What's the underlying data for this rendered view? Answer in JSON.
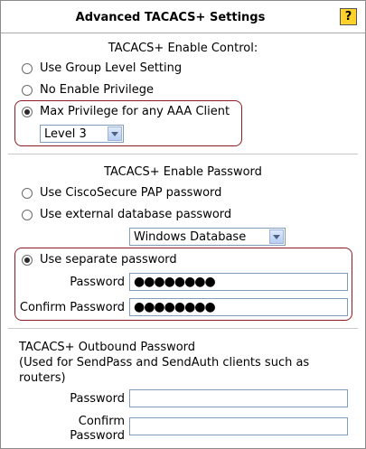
{
  "header": {
    "title": "Advanced TACACS+ Settings",
    "help_label": "?"
  },
  "enable_control": {
    "title": "TACACS+ Enable Control:",
    "options": [
      {
        "label": "Use Group Level Setting",
        "selected": false
      },
      {
        "label": "No Enable Privilege",
        "selected": false
      },
      {
        "label": "Max Privilege for any AAA Client",
        "selected": true
      }
    ],
    "level_select": "Level 3"
  },
  "enable_password": {
    "title": "TACACS+ Enable Password",
    "options": [
      {
        "label": "Use CiscoSecure PAP password",
        "selected": false
      },
      {
        "label": "Use external database password",
        "selected": false
      },
      {
        "label": "Use separate password",
        "selected": true
      }
    ],
    "database_select": "Windows Database",
    "password_label": "Password",
    "password_value": "●●●●●●●●",
    "confirm_label": "Confirm Password",
    "confirm_value": "●●●●●●●●"
  },
  "outbound": {
    "title_line1": "TACACS+ Outbound Password",
    "title_line2": "(Used for SendPass and SendAuth clients such as",
    "title_line3": "routers)",
    "password_label": "Password",
    "confirm_label_line1": "Confirm",
    "confirm_label_line2": "Password",
    "password_value": "",
    "confirm_value": ""
  }
}
